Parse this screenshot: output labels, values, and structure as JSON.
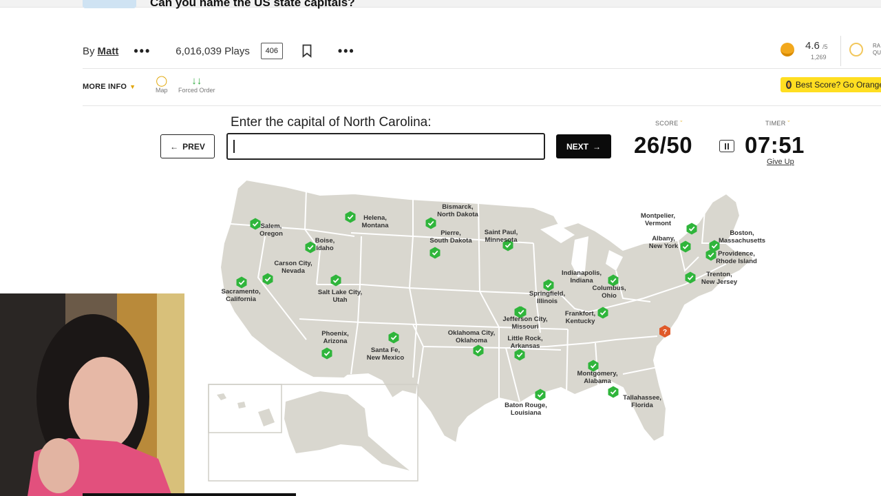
{
  "header": {
    "quiz_title": "Can you name the US state capitals?",
    "by_label": "By",
    "author": "Matt",
    "plays": "6,016,039 Plays",
    "comments": "406",
    "rating": "4.6",
    "rating_scale": "/5",
    "rating_count": "1,269",
    "rank_label": "RA QU"
  },
  "toolbar": {
    "more_info": "MORE INFO",
    "map_label": "Map",
    "forced_order_label": "Forced Order",
    "best_score": "Best Score? Go Orange"
  },
  "quiz": {
    "prompt": "Enter the capital of North Carolina:",
    "prev_label": "PREV",
    "next_label": "NEXT",
    "input_value": "",
    "score_label": "SCORE",
    "timer_label": "TIMER",
    "score": "26/50",
    "timer": "07:51",
    "give_up": "Give Up"
  },
  "map": {
    "capitals": [
      {
        "id": "salem",
        "text": "Salem,\nOregon"
      },
      {
        "id": "helena",
        "text": "Helena,\nMontana"
      },
      {
        "id": "bismarck",
        "text": "Bismarck,\nNorth Dakota"
      },
      {
        "id": "boise",
        "text": "Boise,\nIdaho"
      },
      {
        "id": "pierre",
        "text": "Pierre,\nSouth Dakota"
      },
      {
        "id": "stpaul",
        "text": "Saint Paul,\nMinnesota"
      },
      {
        "id": "montpelier",
        "text": "Montpelier,\nVermont"
      },
      {
        "id": "boston",
        "text": "Boston,\nMassachusetts"
      },
      {
        "id": "albany",
        "text": "Albany,\nNew York"
      },
      {
        "id": "providence",
        "text": "Providence,\nRhode Island"
      },
      {
        "id": "carson",
        "text": "Carson City,\nNevada"
      },
      {
        "id": "sacramento",
        "text": "Sacramento,\nCalifornia"
      },
      {
        "id": "slc",
        "text": "Salt Lake City,\nUtah"
      },
      {
        "id": "indianapolis",
        "text": "Indianapolis,\nIndiana"
      },
      {
        "id": "columbus",
        "text": "Columbus,\nOhio"
      },
      {
        "id": "trenton",
        "text": "Trenton,\nNew Jersey"
      },
      {
        "id": "springfield",
        "text": "Springfield,\nIllinois"
      },
      {
        "id": "frankfort",
        "text": "Frankfort,\nKentucky"
      },
      {
        "id": "jefferson",
        "text": "Jefferson City,\nMissouri"
      },
      {
        "id": "phoenix",
        "text": "Phoenix,\nArizona"
      },
      {
        "id": "santafe",
        "text": "Santa Fe,\nNew Mexico"
      },
      {
        "id": "okc",
        "text": "Oklahoma City,\nOklahoma"
      },
      {
        "id": "littlerock",
        "text": "Little Rock,\nArkansas"
      },
      {
        "id": "montgomery",
        "text": "Montgomery,\nAlabama"
      },
      {
        "id": "tallahassee",
        "text": "Tallahassee,\nFlorida"
      },
      {
        "id": "batonrouge",
        "text": "Baton Rouge,\nLouisiana"
      }
    ],
    "colors": {
      "land": "#d9d7cf",
      "border": "#ffffff",
      "correct": "#2fb53b",
      "current": "#e05a2a"
    }
  }
}
